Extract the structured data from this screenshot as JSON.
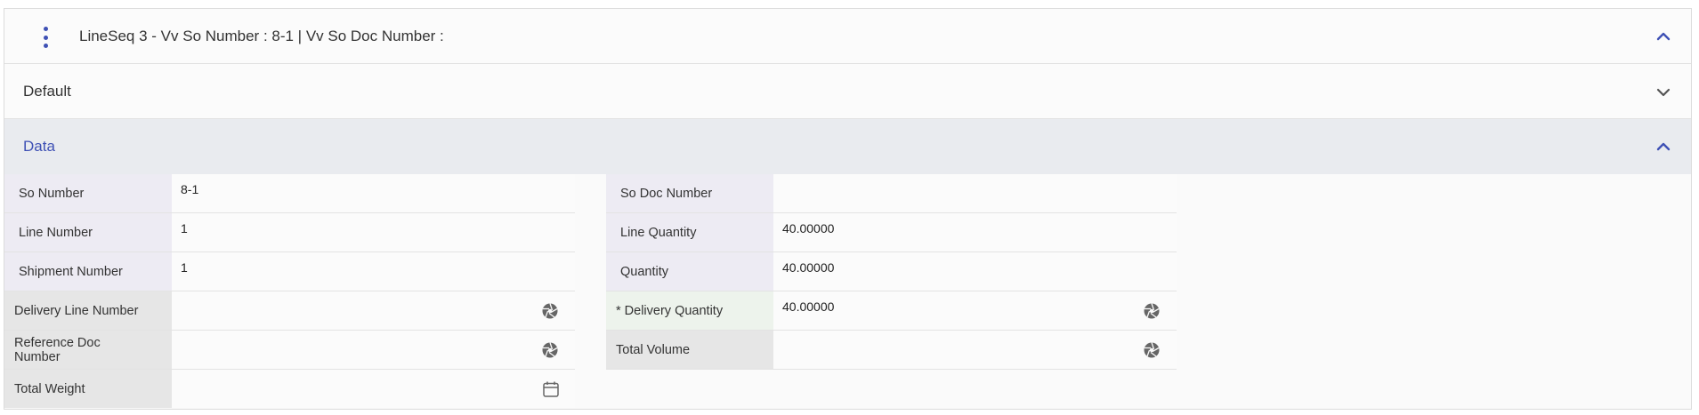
{
  "header": {
    "title": "LineSeq 3 - Vv So Number  : 8-1 | Vv So Doc Number  :"
  },
  "sections": {
    "default_label": "Default",
    "data_label": "Data"
  },
  "fields_left": [
    {
      "label": "So Number",
      "value": "8-1"
    },
    {
      "label": "Line Number",
      "value": "1"
    },
    {
      "label": "Shipment Number",
      "value": "1"
    },
    {
      "label": "Delivery Line Number",
      "value": ""
    },
    {
      "label": "Reference Doc Number",
      "value": ""
    },
    {
      "label": "Total Weight",
      "value": ""
    }
  ],
  "fields_right": [
    {
      "label": "So Doc Number",
      "value": ""
    },
    {
      "label": "Line Quantity",
      "value": "40.00000"
    },
    {
      "label": "Quantity",
      "value": "40.00000"
    },
    {
      "label": "* Delivery Quantity",
      "value": "40.00000"
    },
    {
      "label": "Total Volume",
      "value": ""
    }
  ],
  "icons": {
    "menu": "kebab-menu-icon",
    "collapse": "chevron-up-icon",
    "expand": "chevron-down-icon",
    "field_action": "aperture-icon",
    "date": "calendar-icon"
  },
  "colors": {
    "accent": "#3f51b5",
    "readonly_label_bg": "#edebf3",
    "editable_label_bg": "#e6e6e6",
    "required_label_bg": "#edf3ec",
    "section_active_bg": "#e9ebef"
  }
}
